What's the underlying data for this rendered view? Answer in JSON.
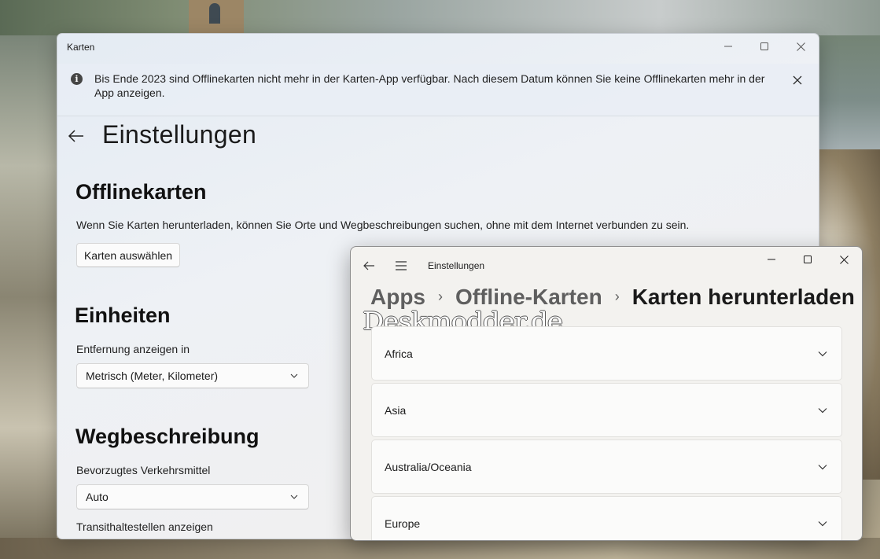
{
  "karten_window": {
    "title": "Karten",
    "banner": {
      "text": "Bis Ende 2023 sind Offlinekarten nicht mehr in der Karten-App verfügbar. Nach diesem Datum können Sie keine Offlinekarten mehr in der App anzeigen."
    },
    "heading": "Einstellungen",
    "offline": {
      "title": "Offlinekarten",
      "description": "Wenn Sie Karten herunterladen, können Sie Orte und Wegbeschreibungen suchen, ohne mit dem Internet verbunden zu sein.",
      "button_label": "Karten auswählen"
    },
    "units": {
      "title": "Einheiten",
      "label": "Entfernung anzeigen in",
      "selected": "Metrisch (Meter, Kilometer)"
    },
    "directions": {
      "title": "Wegbeschreibung",
      "label": "Bevorzugtes Verkehrsmittel",
      "selected": "Auto",
      "transit_label": "Transithaltestellen anzeigen"
    }
  },
  "settings_window": {
    "title": "Einstellungen",
    "breadcrumb": [
      "Apps",
      "Offline-Karten",
      "Karten herunterladen"
    ],
    "watermark": "Deskmodder.de",
    "regions": [
      "Africa",
      "Asia",
      "Australia/Oceania",
      "Europe"
    ]
  },
  "icons": [
    "info-icon",
    "close-icon",
    "back-arrow-icon",
    "minimize-icon",
    "maximize-icon",
    "hamburger-menu-icon",
    "chevron-down-icon",
    "chevron-right-icon"
  ]
}
